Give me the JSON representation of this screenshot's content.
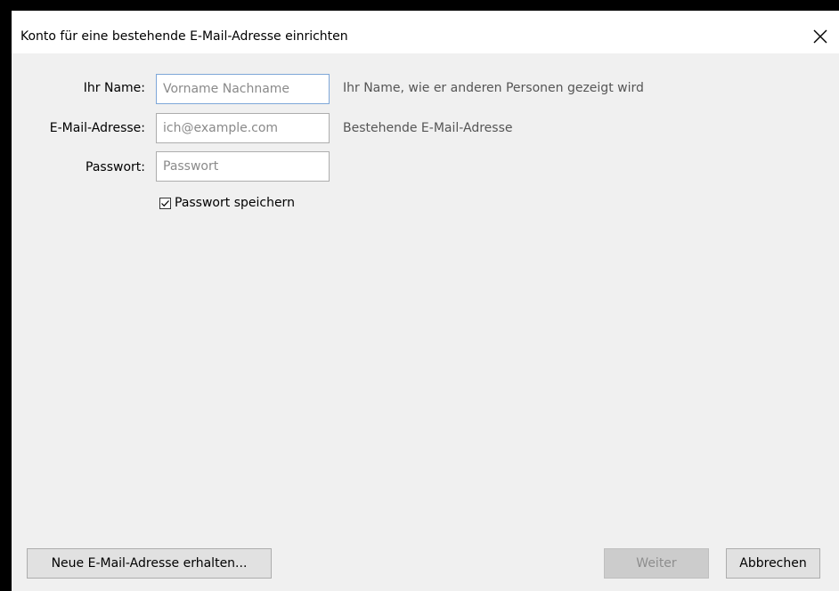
{
  "window": {
    "title": "Konto für eine bestehende E-Mail-Adresse einrichten"
  },
  "form": {
    "name": {
      "label": "Ihr Name:",
      "placeholder": "Vorname Nachname",
      "hint": "Ihr Name, wie er anderen Personen gezeigt wird"
    },
    "email": {
      "label": "E-Mail-Adresse:",
      "placeholder": "ich@example.com",
      "hint": "Bestehende E-Mail-Adresse"
    },
    "password": {
      "label": "Passwort:",
      "placeholder": "Passwort"
    },
    "remember": {
      "label": "Passwort speichern",
      "checked": true
    }
  },
  "buttons": {
    "new_address": "Neue E-Mail-Adresse erhalten...",
    "next": "Weiter",
    "cancel": "Abbrechen"
  },
  "icons": {
    "close": "close-icon",
    "check": "checkmark-icon"
  },
  "colors": {
    "dialog_background": "#f0f0f0",
    "titlebar_background": "#ffffff",
    "focus_border": "#7ea7d8",
    "outer_background": "#000000"
  }
}
